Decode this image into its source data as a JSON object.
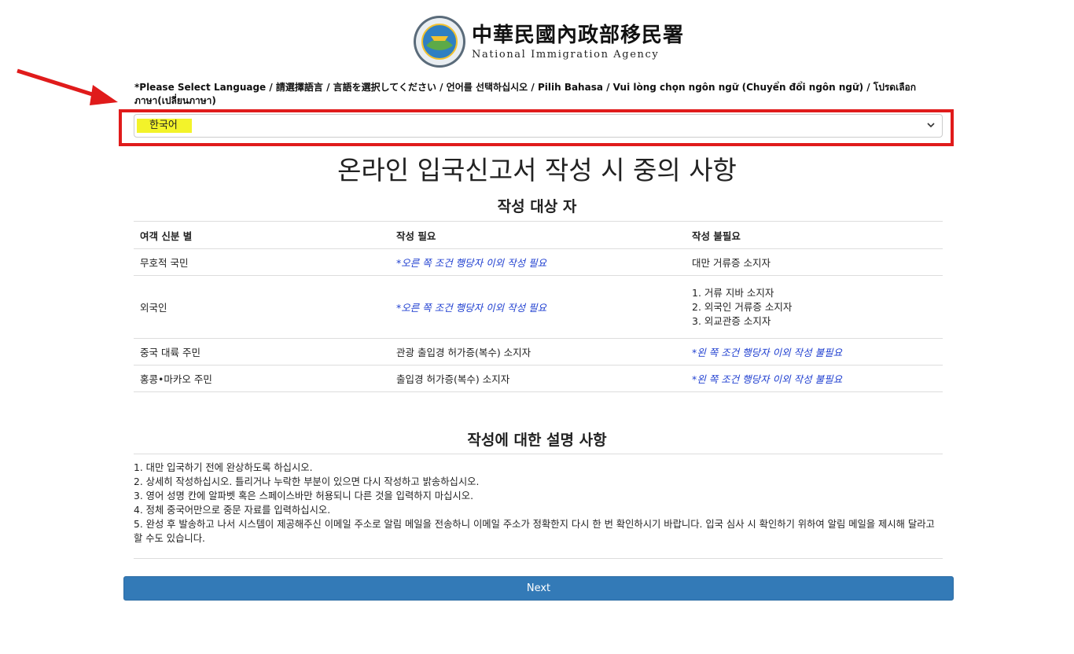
{
  "header": {
    "agency_zh": "中華民國內政部移民署",
    "agency_en": "National Immigration Agency",
    "seal_text": "National Immigration Agency"
  },
  "language": {
    "label": "*Please Select Language / 請選擇語言 / 言語を選択してください / 언어를 선택하십시오 / Pilih Bahasa / Vui lòng chọn ngôn ngữ (Chuyển đổi ngôn ngữ) / โปรดเลือกภาษา(เปลี่ยนภาษา)",
    "selected": "한국어",
    "highlight_color": "#f3f32a"
  },
  "annotation": {
    "frame_color": "#e01b1b",
    "arrow_color": "#e01b1b"
  },
  "title": "온라인 입국신고서 작성 시 중의 사항",
  "eligibility": {
    "heading": "작성 대상 자",
    "columns": [
      "여객 신분 별",
      "작성 필요",
      "작성 불필요"
    ],
    "rows": [
      {
        "identity": "무호적 국민",
        "required": "*오른 쪽 조건 행당자 이외 작성 필요",
        "not_required": "대만 거류증 소지자"
      },
      {
        "identity": "외국인",
        "required": "*오른 쪽 조건 행당자 이외 작성 필요",
        "not_required_lines": [
          "1. 거류 지바 소지자",
          "2. 외국인 거류증 소지자",
          "3. 외교관증 소지자"
        ]
      },
      {
        "identity": "중국 대륙 주민",
        "required": "관광 출입경 허가증(복수) 소지자",
        "not_required": "*왼 쪽 조건 행당자 이외 작성 불필요"
      },
      {
        "identity": "홍콩•마카오 주민",
        "required": "출입경 허가증(복수) 소지자",
        "not_required": "*왼 쪽 조건 행당자 이외 작성 불필요"
      }
    ]
  },
  "instructions": {
    "heading": "작성에 대한 설명 사항",
    "items": [
      "1. 대만 입국하기 전에 완상하도록 하십시오.",
      "2. 상세히 작성하십시오. 틀리거나 누락한 부분이 있으면 다시 작성하고 밝송하십시오.",
      "3. 영어 성명 칸에 알파벳 혹은 스페이스바만 허용되니 다른 것을 입력하지 마십시오.",
      "4. 정체 중국어만으로 중문 자료를 입력하십시오.",
      "5. 완성 후 발송하고 나서 시스템이 제공해주신 이메일 주소로 알림 메일을 전송하니 이메일 주소가 정확한지 다시 한 번 확인하시기 바랍니다. 입국 심사 시 확인하기 위하여 알림 메일을 제시해 달라고 할 수도 있습니다."
    ]
  },
  "next_label": "Next",
  "colors": {
    "accent": "#337ab7",
    "note_blue": "#1f3fd0"
  }
}
